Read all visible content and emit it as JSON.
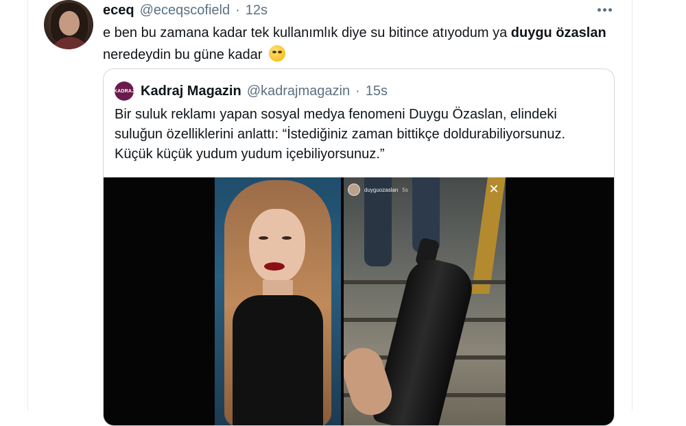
{
  "tweet": {
    "display_name": "eceq",
    "handle": "@eceqscofield",
    "separator": "·",
    "time": "12s",
    "text_part1": "e ben bu zamana kadar tek kullanımlık diye su bitince atıyodum ya ",
    "text_bold": "duygu özaslan",
    "text_part2": " neredeydin bu güne kadar",
    "emoji_icon": "rolling-eyes-emoji"
  },
  "quoted_tweet": {
    "avatar_text": "KADRAJ",
    "display_name": "Kadraj Magazin",
    "handle": "@kadrajmagazin",
    "separator": "·",
    "time": "15s",
    "text": "Bir suluk reklamı yapan sosyal medya fenomeni Duygu Özaslan, elindeki suluğun özelliklerini anlattı: “İstediğiniz zaman bittikçe doldurabiliyorsunuz. Küçük küçük yudum yudum içebiliyorsunuz.”",
    "media": {
      "story_username": "duyguozaslan",
      "story_time": "5s",
      "close_symbol": "✕"
    }
  },
  "colors": {
    "secondary_text": "#5b7083",
    "border": "#cfd9de",
    "quote_avatar_bg": "#6a1b4d"
  }
}
